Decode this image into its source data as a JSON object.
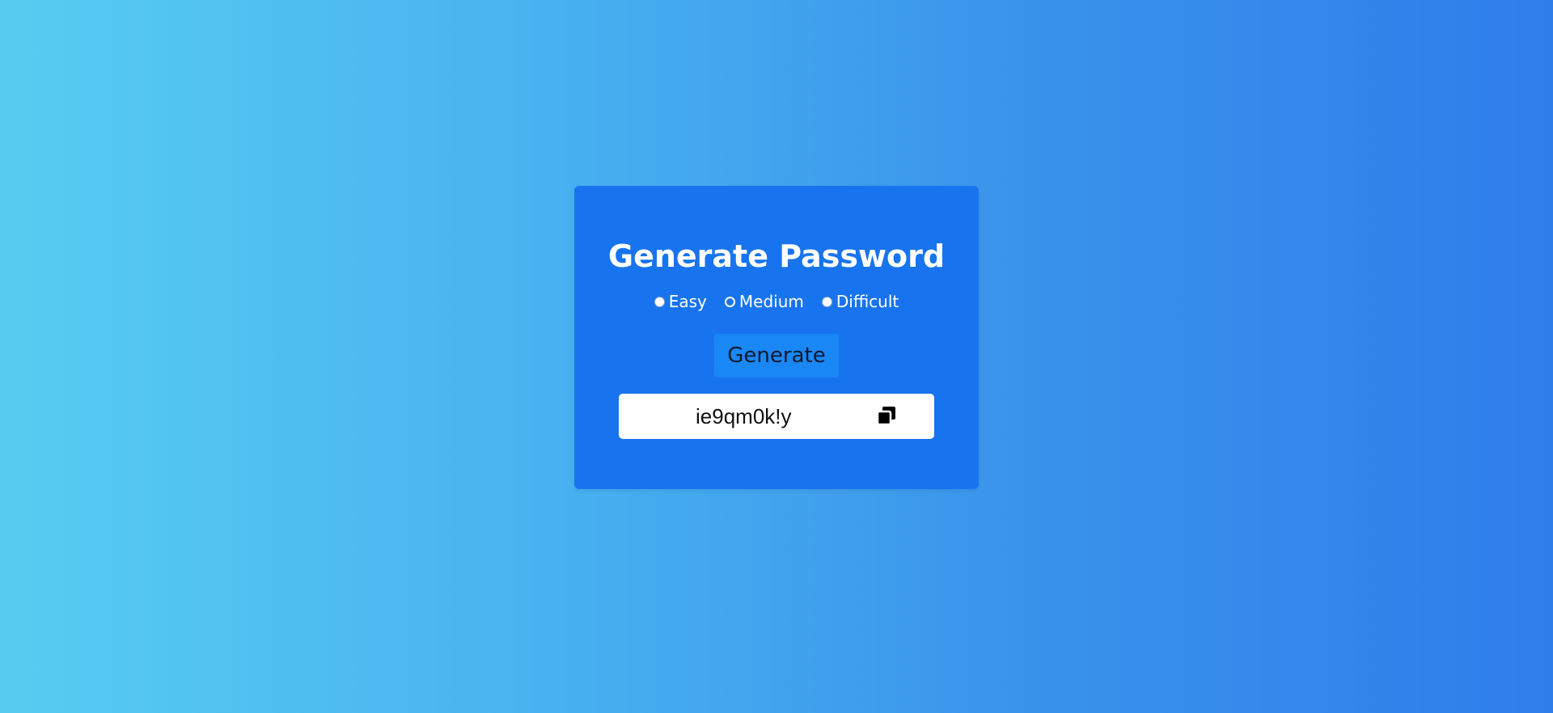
{
  "card": {
    "title": "Generate Password"
  },
  "difficulty": {
    "options": [
      {
        "label": "Easy",
        "selected": false
      },
      {
        "label": "Medium",
        "selected": false
      },
      {
        "label": "Difficult",
        "selected": false
      }
    ]
  },
  "actions": {
    "generate_label": "Generate"
  },
  "output": {
    "password": "ie9qm0k!y",
    "copy_icon": "copy-icon"
  },
  "colors": {
    "background_start": "#57cdf1",
    "background_end": "#2f7deb",
    "card": "#1874ee",
    "button": "#1a87f7",
    "text": "#ffffff"
  }
}
